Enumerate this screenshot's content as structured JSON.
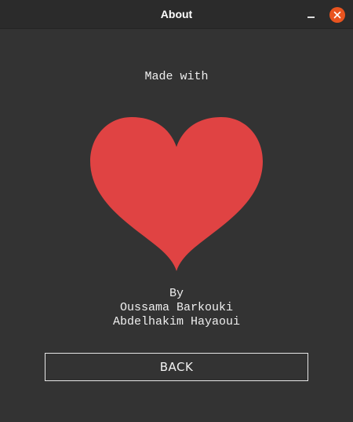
{
  "window": {
    "title": "About"
  },
  "main": {
    "made_with": "Made with",
    "by_label": "By",
    "authors": [
      "Oussama Barkouki",
      "Abdelhakim Hayaoui"
    ],
    "back_label": "BACK"
  },
  "icons": {
    "heart": "heart-icon",
    "minimize": "minimize-icon",
    "close": "close-icon"
  },
  "colors": {
    "background": "#333333",
    "titlebar": "#2b2b2b",
    "heart": "#e04343",
    "close_button": "#e9541f",
    "text": "#eeeeee"
  }
}
